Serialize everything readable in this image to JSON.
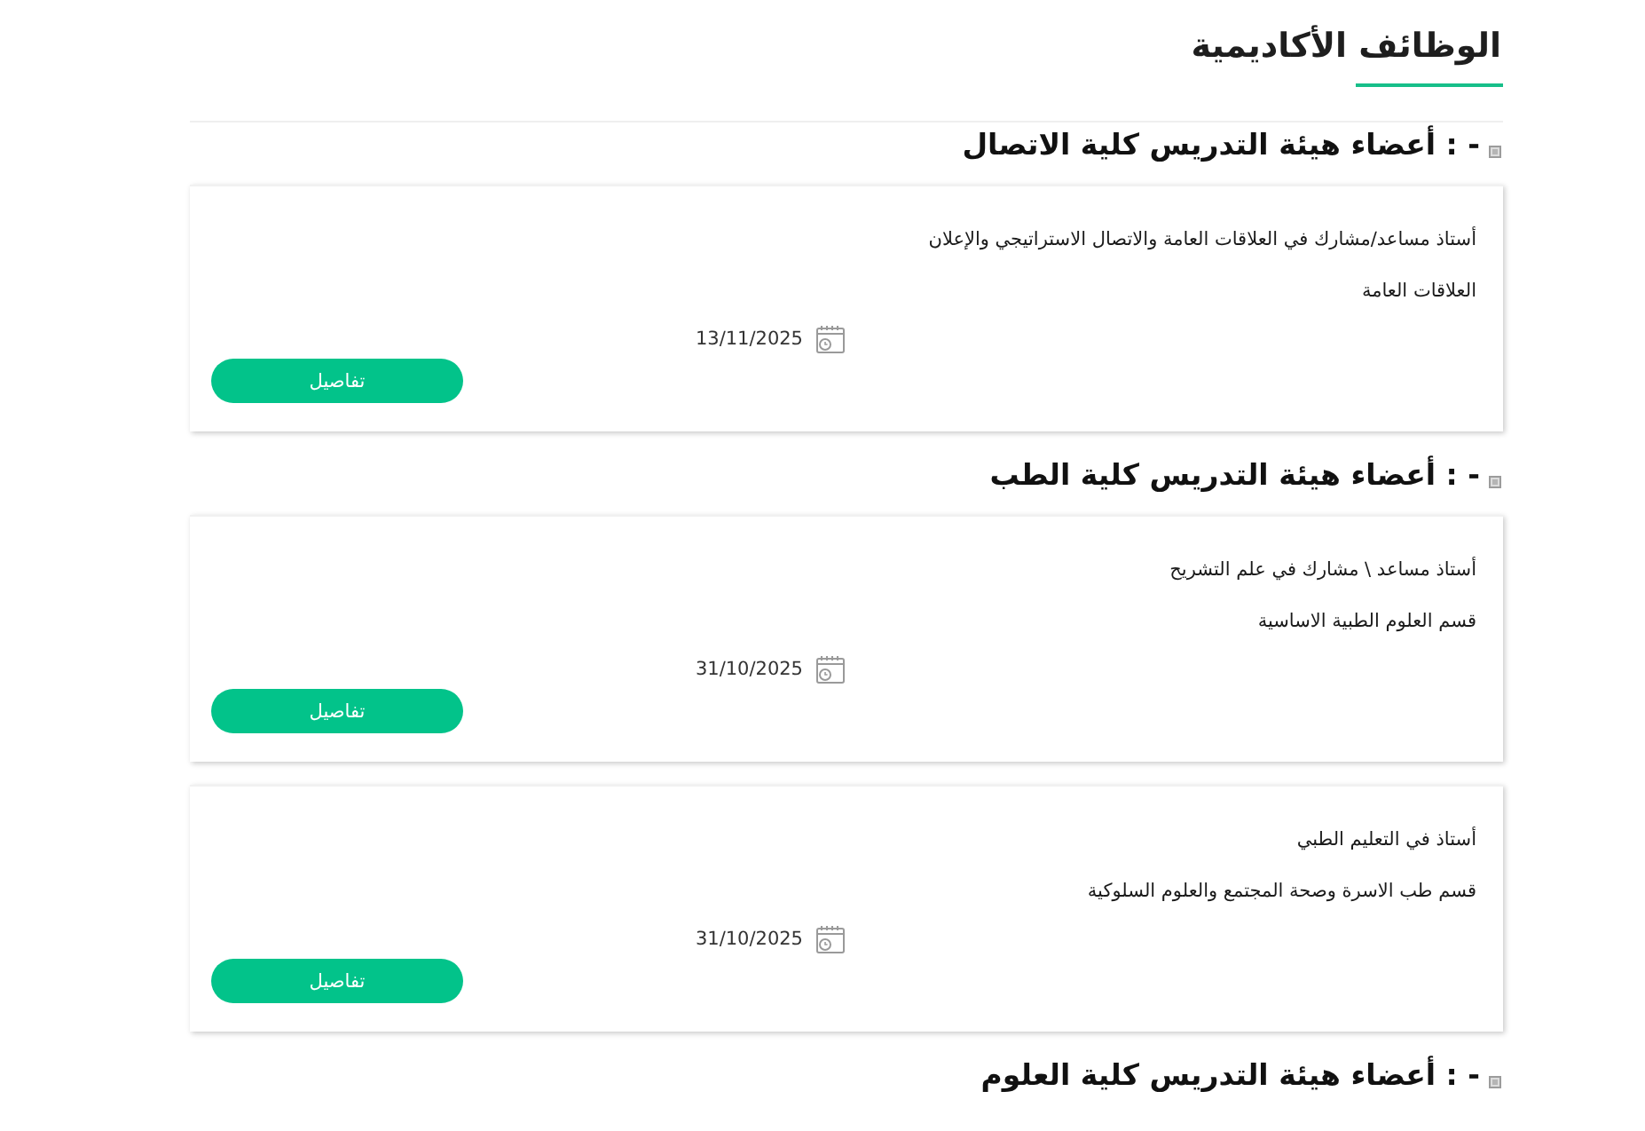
{
  "page": {
    "title": "الوظائف الأكاديمية"
  },
  "sections": [
    {
      "heading": "- : أعضاء هيئة التدريس كلية الاتصال",
      "jobs": [
        {
          "title": "أستاذ مساعد/مشارك في العلاقات العامة والاتصال الاستراتيجي والإعلان",
          "department": "العلاقات العامة",
          "date": "13/11/2025",
          "button": "تفاصيل"
        }
      ]
    },
    {
      "heading": "- : أعضاء هيئة التدريس كلية الطب",
      "jobs": [
        {
          "title": "أستاذ مساعد \\ مشارك في علم التشريح",
          "department": "قسم العلوم الطبية الاساسية",
          "date": "31/10/2025",
          "button": "تفاصيل"
        },
        {
          "title": "أستاذ في التعليم الطبي",
          "department": "قسم طب الاسرة وصحة المجتمع والعلوم السلوكية",
          "date": "31/10/2025",
          "button": "تفاصيل"
        }
      ]
    },
    {
      "heading": "- : أعضاء هيئة التدريس كلية العلوم"
    }
  ]
}
